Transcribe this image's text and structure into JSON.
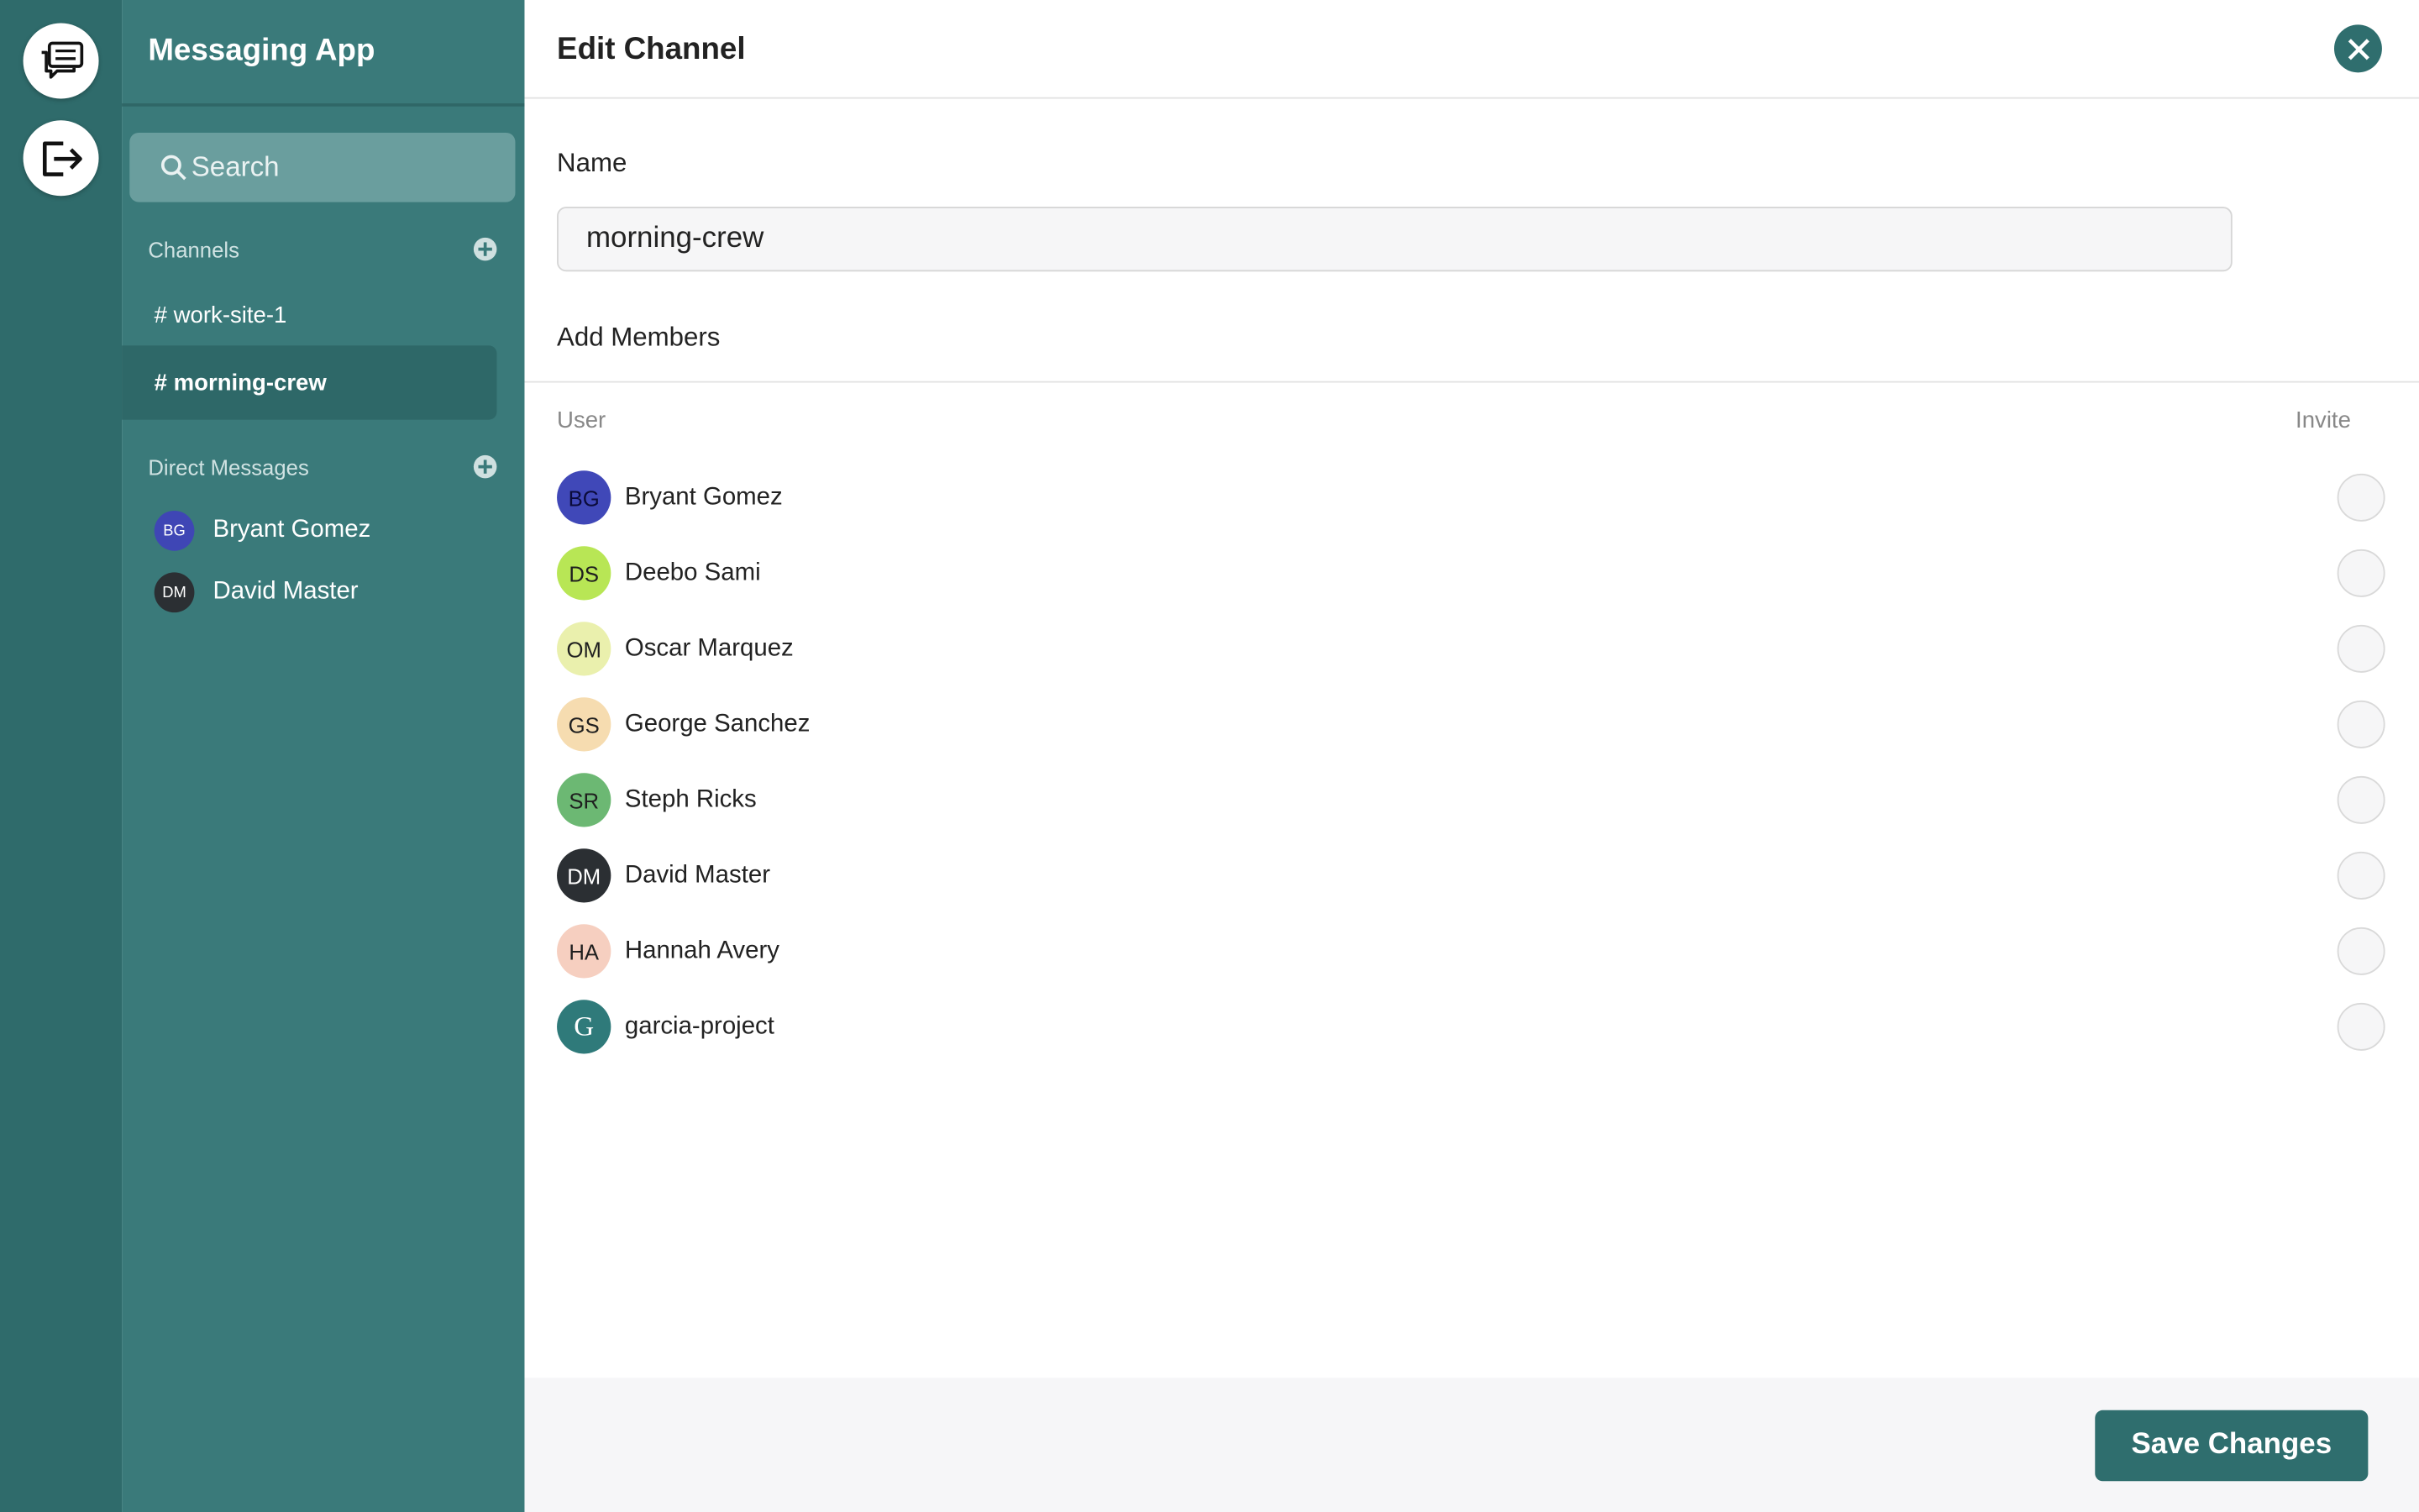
{
  "app": {
    "title": "Messaging App"
  },
  "rail": {
    "chat_icon": "chat-bubbles-icon",
    "logout_icon": "logout-icon"
  },
  "sidebar": {
    "search_placeholder": "Search",
    "channels_label": "Channels",
    "channels": [
      {
        "label": "# work-site-1",
        "active": false
      },
      {
        "label": "# morning-crew",
        "active": true
      }
    ],
    "dm_label": "Direct Messages",
    "dms": [
      {
        "initials": "BG",
        "name": "Bryant Gomez",
        "color": "#3f46b5"
      },
      {
        "initials": "DM",
        "name": "David Master",
        "color": "#2b2f33"
      }
    ]
  },
  "modal": {
    "title": "Edit Channel",
    "name_label": "Name",
    "name_value": "morning-crew",
    "add_members_label": "Add Members",
    "col_user": "User",
    "col_invite": "Invite",
    "members": [
      {
        "initials": "BG",
        "name": "Bryant Gomez",
        "color": "#4048b8",
        "text_color": "#0b0b3a"
      },
      {
        "initials": "DS",
        "name": "Deebo Sami",
        "color": "#b8e655",
        "text_color": "#1f1f1f"
      },
      {
        "initials": "OM",
        "name": "Oscar Marquez",
        "color": "#eaf0ad",
        "text_color": "#1f1f1f"
      },
      {
        "initials": "GS",
        "name": "George Sanchez",
        "color": "#f6dcb0",
        "text_color": "#1f1f1f"
      },
      {
        "initials": "SR",
        "name": "Steph Ricks",
        "color": "#6cb873",
        "text_color": "#1f1f1f"
      },
      {
        "initials": "DM",
        "name": "David Master",
        "color": "#2b2f33",
        "text_color": "#ffffff"
      },
      {
        "initials": "HA",
        "name": "Hannah Avery",
        "color": "#f6cfc0",
        "text_color": "#1f1f1f"
      },
      {
        "initials": "G",
        "name": "garcia-project",
        "color": "#2f7a7a",
        "text_color": "#ffffff"
      }
    ],
    "save_label": "Save Changes"
  },
  "colors": {
    "accent": "#2f6e6e",
    "sidebar": "#3a7a7a",
    "rail": "#2f6b6b"
  }
}
